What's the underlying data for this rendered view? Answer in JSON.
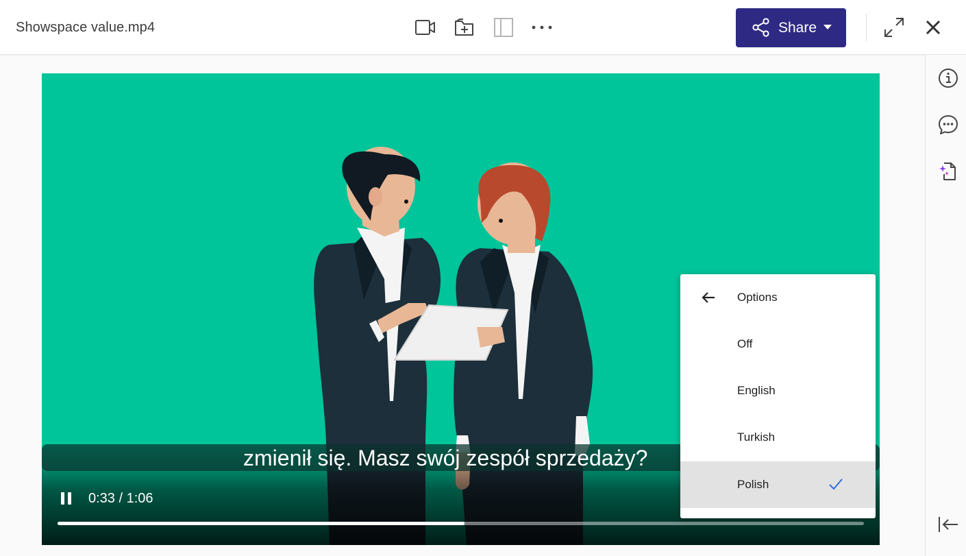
{
  "file_title": "Showspace value.mp4",
  "toolbar": {
    "share_label": "Share"
  },
  "video": {
    "subtitle": "zmienił się. Masz swój zespół sprzedaży?",
    "time_display": "0:33 / 1:06",
    "progress_fraction": 0.505
  },
  "captions_menu": {
    "header_label": "Options",
    "items": [
      {
        "label": "Off",
        "selected": false
      },
      {
        "label": "English",
        "selected": false
      },
      {
        "label": "Turkish",
        "selected": false
      },
      {
        "label": "Polish",
        "selected": true
      }
    ]
  },
  "colors": {
    "accent": "#2e2a83",
    "video_bg": "#00c49a",
    "check": "#2f6fde"
  },
  "icons": [
    "video-camera-icon",
    "folder-add-icon",
    "split-view-icon",
    "more-options-icon",
    "share-icon",
    "chevron-down-icon",
    "expand-icon",
    "close-icon",
    "info-icon",
    "comment-icon",
    "ai-document-icon",
    "collapse-panel-icon",
    "pause-icon",
    "back-arrow-icon",
    "checkmark-icon"
  ]
}
